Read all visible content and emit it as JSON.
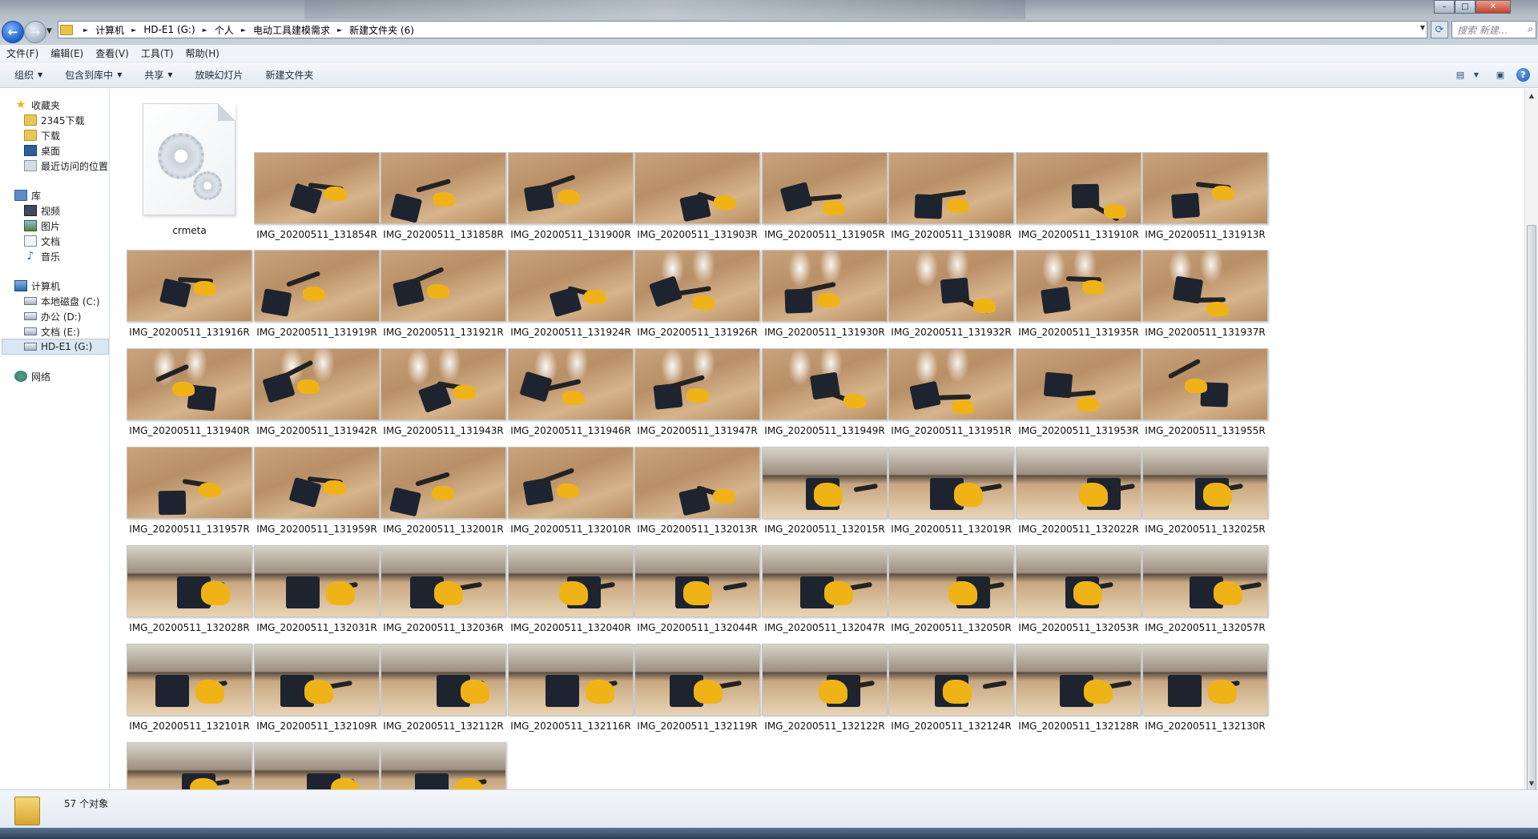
{
  "address": {
    "crumbs": [
      "计算机",
      "HD-E1 (G:)",
      "个人",
      "电动工具建模需求",
      "新建文件夹 (6)"
    ],
    "search_placeholder": "搜索 新建..."
  },
  "menu": [
    "文件(F)",
    "编辑(E)",
    "查看(V)",
    "工具(T)",
    "帮助(H)"
  ],
  "commands": [
    {
      "label": "组织",
      "dropdown": true
    },
    {
      "label": "包含到库中",
      "dropdown": true
    },
    {
      "label": "共享",
      "dropdown": true
    },
    {
      "label": "放映幻灯片",
      "dropdown": false
    },
    {
      "label": "新建文件夹",
      "dropdown": false
    }
  ],
  "nav": {
    "favorites": {
      "label": "收藏夹",
      "items": [
        "2345下载",
        "下载",
        "桌面",
        "最近访问的位置"
      ]
    },
    "libraries": {
      "label": "库",
      "items": [
        "视频",
        "图片",
        "文档",
        "音乐"
      ]
    },
    "computer": {
      "label": "计算机",
      "items": [
        "本地磁盘 (C:)",
        "办公 (D:)",
        "文档 (E:)",
        "HD-E1 (G:)"
      ],
      "selected": "HD-E1 (G:)"
    },
    "network": {
      "label": "网络"
    }
  },
  "files": [
    "crmeta",
    "IMG_20200511_131854R",
    "IMG_20200511_131858R",
    "IMG_20200511_131900R",
    "IMG_20200511_131903R",
    "IMG_20200511_131905R",
    "IMG_20200511_131908R",
    "IMG_20200511_131910R",
    "IMG_20200511_131913R",
    "IMG_20200511_131916R",
    "IMG_20200511_131919R",
    "IMG_20200511_131921R",
    "IMG_20200511_131924R",
    "IMG_20200511_131926R",
    "IMG_20200511_131930R",
    "IMG_20200511_131932R",
    "IMG_20200511_131935R",
    "IMG_20200511_131937R",
    "IMG_20200511_131940R",
    "IMG_20200511_131942R",
    "IMG_20200511_131943R",
    "IMG_20200511_131946R",
    "IMG_20200511_131947R",
    "IMG_20200511_131949R",
    "IMG_20200511_131951R",
    "IMG_20200511_131953R",
    "IMG_20200511_131955R",
    "IMG_20200511_131957R",
    "IMG_20200511_131959R",
    "IMG_20200511_132001R",
    "IMG_20200511_132010R",
    "IMG_20200511_132013R",
    "IMG_20200511_132015R",
    "IMG_20200511_132019R",
    "IMG_20200511_132022R",
    "IMG_20200511_132025R",
    "IMG_20200511_132028R",
    "IMG_20200511_132031R",
    "IMG_20200511_132036R",
    "IMG_20200511_132040R",
    "IMG_20200511_132044R",
    "IMG_20200511_132047R",
    "IMG_20200511_132050R",
    "IMG_20200511_132053R",
    "IMG_20200511_132057R",
    "IMG_20200511_132101R",
    "IMG_20200511_132109R",
    "IMG_20200511_132112R",
    "IMG_20200511_132116R",
    "IMG_20200511_132119R",
    "IMG_20200511_132122R",
    "IMG_20200511_132124R",
    "IMG_20200511_132128R",
    "IMG_20200511_132130R",
    "",
    "",
    ""
  ],
  "status": {
    "count_text": "57 个对象"
  }
}
